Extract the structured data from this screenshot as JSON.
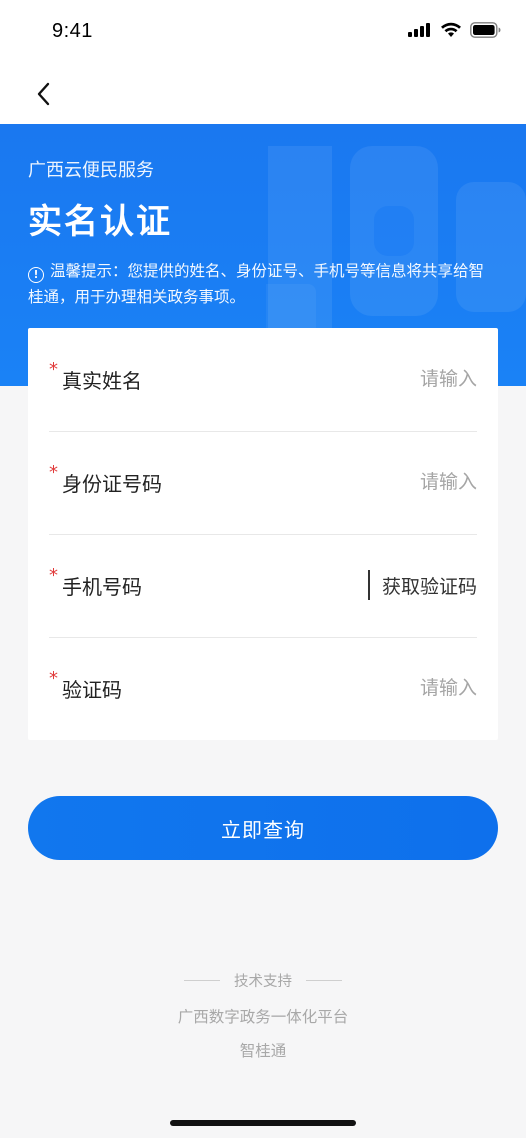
{
  "status": {
    "time": "9:41"
  },
  "nav": {
    "back_icon": "chevron-left-icon"
  },
  "hero": {
    "subtitle": "广西云便民服务",
    "title": "实名认证",
    "tip_icon": "!",
    "tip": "温馨提示：您提供的姓名、身份证号、手机号等信息将共享给智桂通，用于办理相关政务事项。",
    "color": "#1a7cf3"
  },
  "form": {
    "required_mark": "*",
    "fields": [
      {
        "label": "真实姓名",
        "placeholder": "请输入"
      },
      {
        "label": "身份证号码",
        "placeholder": "请输入"
      },
      {
        "label": "手机号码",
        "placeholder": "",
        "action": "获取验证码"
      },
      {
        "label": "验证码",
        "placeholder": "请输入"
      }
    ]
  },
  "submit": {
    "label": "立即查询",
    "color": "#1177ee"
  },
  "footer": {
    "support": "技术支持",
    "org": "广西数字政务一体化平台",
    "app": "智桂通"
  }
}
